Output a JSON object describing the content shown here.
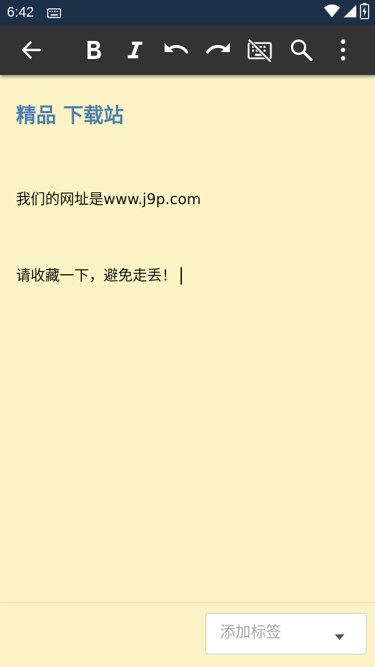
{
  "status_bar": {
    "time": "6:42",
    "icons": [
      "keyboard-icon",
      "wifi-icon",
      "signal-icon",
      "battery-charging-icon"
    ]
  },
  "toolbar": {
    "buttons": [
      "back-arrow-icon",
      "bold-icon",
      "italic-icon",
      "undo-icon",
      "redo-icon",
      "keyboard-hide-icon",
      "search-icon",
      "more-vert-icon"
    ]
  },
  "note": {
    "title": "精品 下载站",
    "lines": [
      "我们的网址是www.j9p.com",
      "请收藏一下，避免走丢！"
    ]
  },
  "bottom": {
    "tag_placeholder": "添加标签",
    "dropdown_icon": "dropdown-arrow-icon"
  },
  "colors": {
    "status_bar": "#1c3048",
    "toolbar": "#333333",
    "note_background": "#fbf3c3",
    "title": "#4a7fb5",
    "text": "#111111"
  }
}
